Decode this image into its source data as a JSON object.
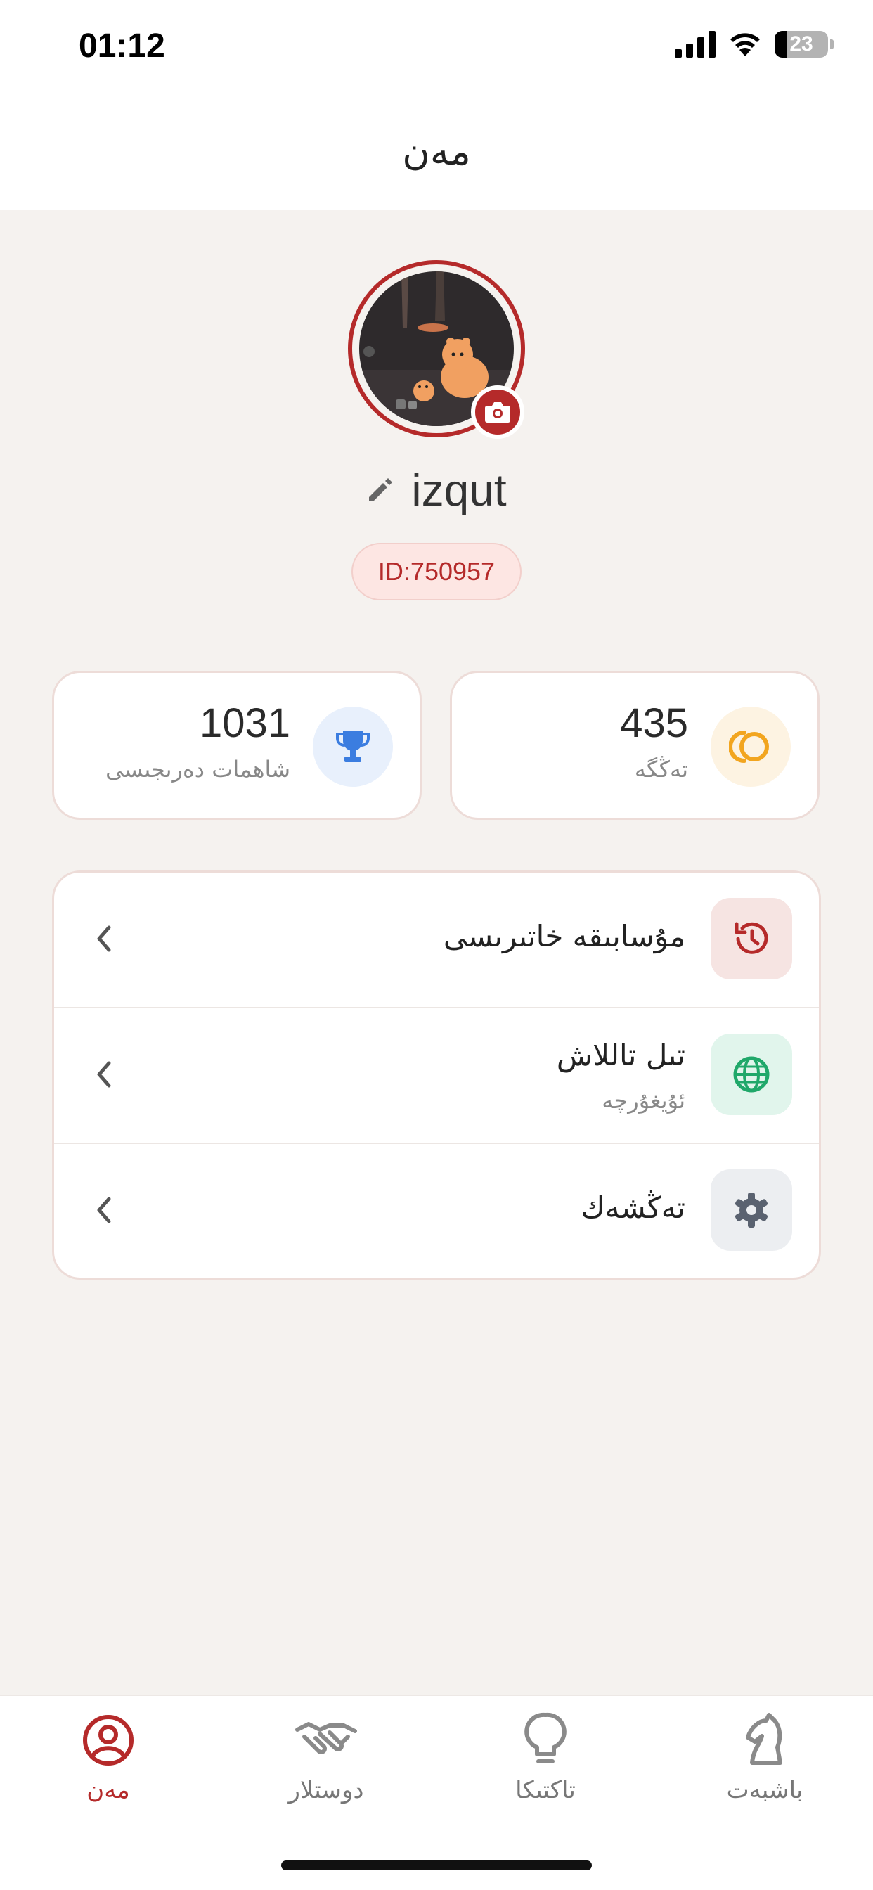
{
  "status_bar": {
    "time": "01:12",
    "battery": "23"
  },
  "header": {
    "title": "مەن"
  },
  "profile": {
    "username": "izqut",
    "id_label": "ID:750957"
  },
  "stats": [
    {
      "value": "1031",
      "label": "شاھمات دەرىجىسى",
      "icon": "trophy-icon",
      "color": "#3b7de0"
    },
    {
      "value": "435",
      "label": "تەڭگە",
      "icon": "coin-icon",
      "color": "#f2a51f"
    }
  ],
  "menu": [
    {
      "title": "مۇسابىقە خاتىرىسى",
      "subtitle": "",
      "icon": "history-icon",
      "color": "#b52a2a"
    },
    {
      "title": "تىل تاللاش",
      "subtitle": "ئۇيغۇرچە",
      "icon": "globe-icon",
      "color": "#20a86a"
    },
    {
      "title": "تەڭشەك",
      "subtitle": "",
      "icon": "gear-icon",
      "color": "#5a6270"
    }
  ],
  "tabs": [
    {
      "label": "مەن",
      "icon": "user-circle-icon",
      "active": true
    },
    {
      "label": "دوستلار",
      "icon": "handshake-icon",
      "active": false
    },
    {
      "label": "تاكتىكا",
      "icon": "lightbulb-icon",
      "active": false
    },
    {
      "label": "باشبەت",
      "icon": "chess-knight-icon",
      "active": false
    }
  ],
  "colors": {
    "accent": "#b52a2a",
    "background": "#f5f2ef"
  }
}
